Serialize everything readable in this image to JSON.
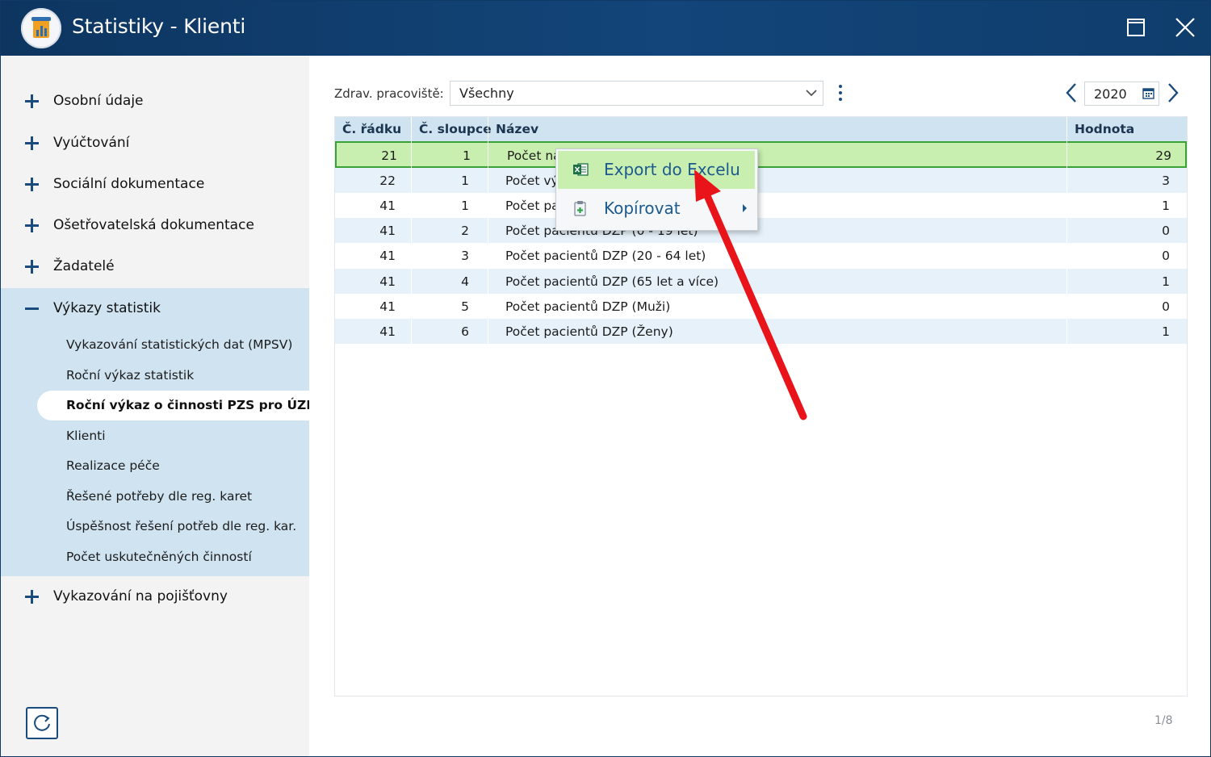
{
  "window": {
    "title": "Statistiky - Klienti"
  },
  "sidebar": {
    "items": [
      {
        "label": "Osobní údaje",
        "state": "collapsed"
      },
      {
        "label": "Vyúčtování",
        "state": "collapsed"
      },
      {
        "label": "Sociální dokumentace",
        "state": "collapsed"
      },
      {
        "label": "Ošetřovatelská dokumentace",
        "state": "collapsed"
      },
      {
        "label": "Žadatelé",
        "state": "collapsed"
      },
      {
        "label": "Výkazy statistik",
        "state": "expanded"
      },
      {
        "label": "Vykazování na pojišťovny",
        "state": "collapsed"
      }
    ],
    "subitems": [
      "Vykazování statistických dat (MPSV)",
      "Roční výkaz statistik",
      "Roční výkaz o činnosti PZS pro ÚZIS",
      "Klienti",
      "Realizace péče",
      "Řešené potřeby dle reg. karet",
      "Úspěšnost řešení potřeb dle reg. kar.",
      "Počet uskutečněných činností"
    ],
    "active_subitem_index": 2
  },
  "filter": {
    "label": "Zdrav. pracoviště:",
    "value": "Všechny",
    "year": "2020"
  },
  "table": {
    "headers": [
      "Č. řádku",
      "Č. sloupce",
      "Název",
      "Hodnota"
    ],
    "rows": [
      {
        "radek": "21",
        "sloupec": "1",
        "nazev": "Počet ná",
        "hodnota": "29"
      },
      {
        "radek": "22",
        "sloupec": "1",
        "nazev": "Počet vý",
        "hodnota": "3"
      },
      {
        "radek": "41",
        "sloupec": "1",
        "nazev": "Počet pa",
        "hodnota": "1"
      },
      {
        "radek": "41",
        "sloupec": "2",
        "nazev": "Počet pacientů DZP (0 - 19 let)",
        "hodnota": "0"
      },
      {
        "radek": "41",
        "sloupec": "3",
        "nazev": "Počet pacientů DZP (20 - 64 let)",
        "hodnota": "0"
      },
      {
        "radek": "41",
        "sloupec": "4",
        "nazev": "Počet pacientů DZP (65 let a více)",
        "hodnota": "1"
      },
      {
        "radek": "41",
        "sloupec": "5",
        "nazev": "Počet pacientů DZP (Muži)",
        "hodnota": "0"
      },
      {
        "radek": "41",
        "sloupec": "6",
        "nazev": "Počet pacientů DZP (Ženy)",
        "hodnota": "1"
      }
    ],
    "selected_row_index": 0
  },
  "context_menu": {
    "items": [
      {
        "label": "Export do Excelu",
        "icon": "excel-icon"
      },
      {
        "label": "Kopírovat",
        "icon": "clipboard-icon"
      }
    ]
  },
  "pager": "1/8",
  "colors": {
    "titlebar": "#13457a",
    "accent": "#1a4b7d",
    "sidebar_expanded": "#cfe3f1",
    "row_alt": "#e6f1f9",
    "row_selected": "#c9efb0",
    "selected_border": "#3aa235",
    "annotation_arrow": "#e8141a"
  }
}
